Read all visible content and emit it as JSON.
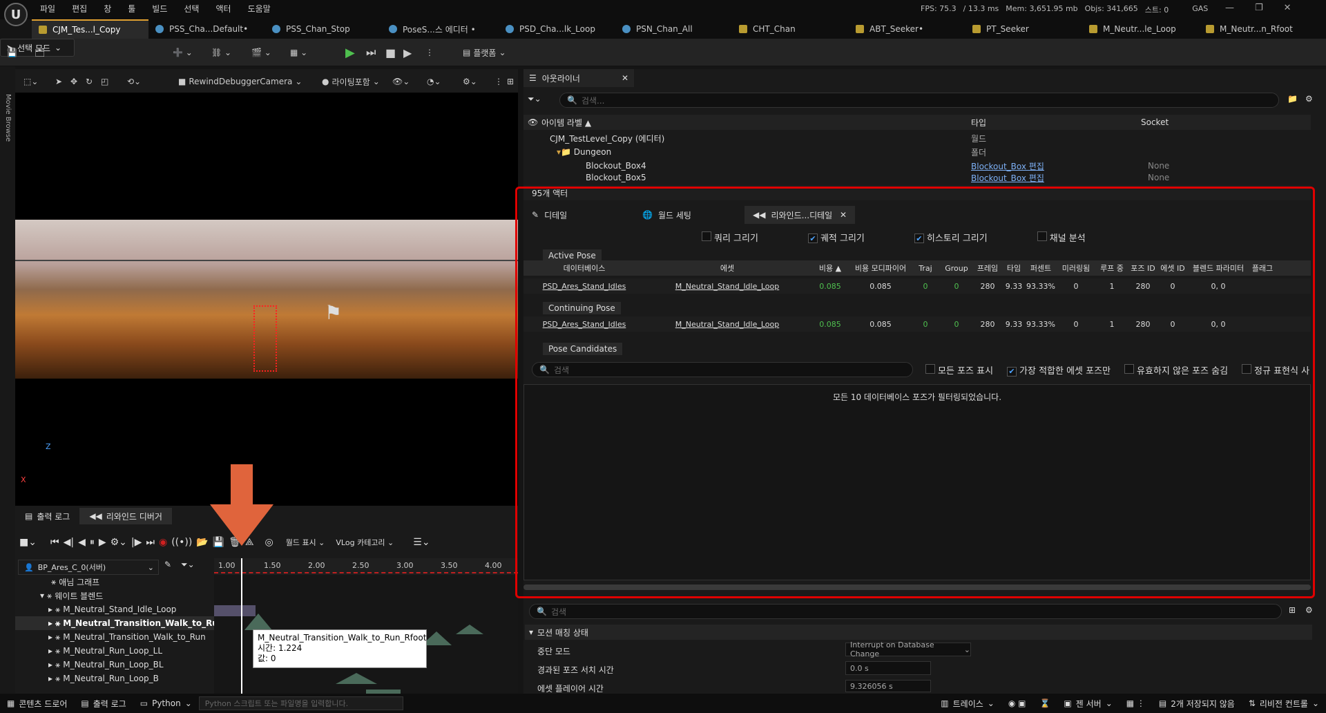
{
  "app": {
    "logo": "U"
  },
  "menu": [
    "파일",
    "편집",
    "창",
    "툴",
    "빌드",
    "선택",
    "액터",
    "도움말"
  ],
  "stats": {
    "fps": "FPS: 75.3",
    "ms": "/ 13.3 ms",
    "mem": "Mem: 3,651.95 mb",
    "objs": "Objs: 341,665",
    "stream": "스트: 0",
    "gas": "GAS"
  },
  "tabs": [
    "CJM_Tes...l_Copy",
    "PSS_Cha...Default•",
    "PSS_Chan_Stop",
    "PoseS...스 에디터 •",
    "PSD_Cha...lk_Loop",
    "PSN_Chan_All",
    "CHT_Chan",
    "ABT_Seeker•",
    "PT_Seeker",
    "M_Neutr...le_Loop",
    "M_Neutr...n_Rfoot"
  ],
  "toolbar": {
    "mode": "선택 모드",
    "platform": "플랫폼"
  },
  "viewport": {
    "camera": "RewindDebuggerCamera",
    "lighting": "라이팅포함",
    "side": "Movie Browse"
  },
  "bottom": {
    "tab_output": "출력 로그",
    "tab_rewind": "리와인드 디버거",
    "world": "월드 표시",
    "vlog": "VLog 카테고리",
    "object": "BP_Ares_C_0(서버)"
  },
  "ruler": [
    "1.00",
    "1.50",
    "2.00",
    "2.50",
    "3.00",
    "3.50",
    "4.00"
  ],
  "tracks": [
    "애님 그래프",
    "웨이트 블렌드",
    "M_Neutral_Stand_Idle_Loop",
    "M_Neutral_Transition_Walk_to_Run",
    "M_Neutral_Transition_Walk_to_Run",
    "M_Neutral_Run_Loop_LL",
    "M_Neutral_Run_Loop_BL",
    "M_Neutral_Run_Loop_B"
  ],
  "tooltip": {
    "name": "M_Neutral_Transition_Walk_to_Run_Rfoot",
    "time": "시간: 1.224",
    "value": "값: 0"
  },
  "outliner": {
    "title": "아웃라이너",
    "search": "검색...",
    "cols": [
      "아이템 라벨 ▲",
      "타입",
      "Socket"
    ],
    "rows": [
      {
        "label": "CJM_TestLevel_Copy (에디터)",
        "type": "월드",
        "socket": ""
      },
      {
        "label": "Dungeon",
        "type": "폴더",
        "socket": ""
      },
      {
        "label": "Blockout_Box4",
        "type": "Blockout_Box 편집",
        "socket": "None"
      },
      {
        "label": "Blockout_Box5",
        "type": "Blockout_Box 편집",
        "socket": "None"
      }
    ],
    "count": "95개 액터"
  },
  "details": {
    "tabs": [
      "디테일",
      "월드 세팅",
      "리와인드...디테일"
    ],
    "checks": [
      {
        "label": "쿼리 그리기",
        "on": false
      },
      {
        "label": "궤적 그리기",
        "on": true
      },
      {
        "label": "히스토리 그리기",
        "on": true
      },
      {
        "label": "채널 분석",
        "on": false
      }
    ],
    "active": "Active Pose",
    "continuing": "Continuing Pose",
    "candidates": "Pose Candidates",
    "cols": [
      "데이터베이스",
      "에셋",
      "비용 ▲",
      "비용 모디파이어",
      "Traj",
      "Group",
      "프레임",
      "타임",
      "퍼센트",
      "미러링됨",
      "루프 중",
      "포즈 ID",
      "에셋 ID",
      "블렌드 파라미터",
      "플래그"
    ],
    "row": [
      "PSD_Ares_Stand_Idles",
      "M_Neutral_Stand_Idle_Loop",
      "0.085",
      "0.085",
      "0",
      "0",
      "280",
      "9.33",
      "93.33%",
      "0",
      "1",
      "280",
      "0",
      "0, 0",
      ""
    ],
    "search": "검색",
    "filters": [
      {
        "label": "모든 포즈 표시",
        "on": false
      },
      {
        "label": "가장 적합한 에셋 포즈만",
        "on": true
      },
      {
        "label": "유효하지 않은 포즈 숨김",
        "on": false
      },
      {
        "label": "정규 표현식 사용",
        "on": false
      }
    ],
    "filtered": "모든 10 데이터베이스 포즈가 필터링되었습니다."
  },
  "lower": {
    "search": "검색",
    "section": "모션 매칭 상태",
    "props": [
      {
        "k": "중단 모드",
        "v": "Interrupt on Database Change"
      },
      {
        "k": "경과된 포즈 서치 시간",
        "v": "0.0 s"
      },
      {
        "k": "에셋 플레이어 시간",
        "v": "9.326056 s"
      }
    ]
  },
  "status": {
    "content": "콘텐츠 드로어",
    "output": "출력 로그",
    "python": "Python",
    "cmd": "Python 스크립트 또는 파일명을 입력합니다.",
    "trace": "트레이스",
    "zen": "젠 서버",
    "unsaved": "2개 저장되지 않음",
    "revision": "리비전 컨트롤"
  },
  "colors": {
    "highlight": "#e00000",
    "arrow": "#e0643c",
    "green": "#4fc04f"
  }
}
